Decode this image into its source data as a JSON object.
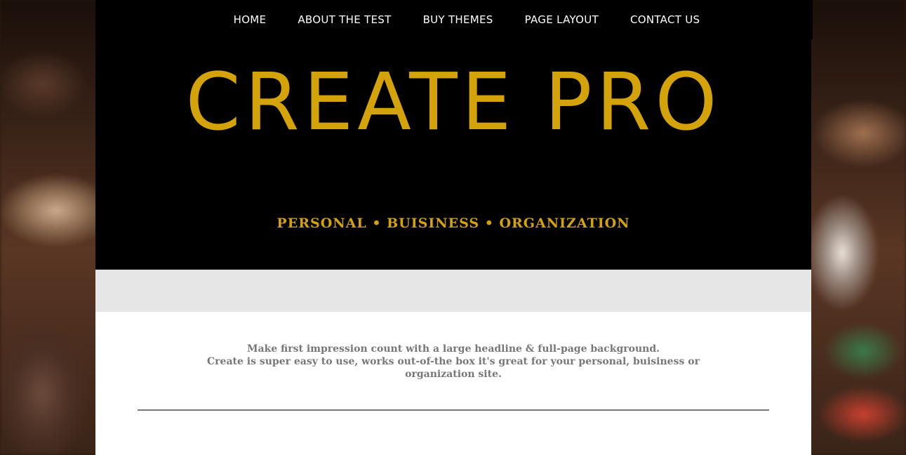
{
  "nav": {
    "items": [
      {
        "label": "HOME"
      },
      {
        "label": "ABOUT THE TEST"
      },
      {
        "label": "BUY THEMES"
      },
      {
        "label": "PAGE LAYOUT"
      },
      {
        "label": "CONTACT US"
      }
    ]
  },
  "hero": {
    "title": "CREATE PRO",
    "tagline": "PERSONAL • BUISINESS • ORGANIZATION"
  },
  "content": {
    "intro_line1": "Make first impression count with a large headline & full-page background.",
    "intro_line2": "Create is super easy to use, works out-of-the box it's great for your personal, buisiness or organization site."
  },
  "colors": {
    "accent": "#d4a30a",
    "header_bg": "#000000",
    "band_bg": "#e6e6e6",
    "body_text": "#777777"
  }
}
